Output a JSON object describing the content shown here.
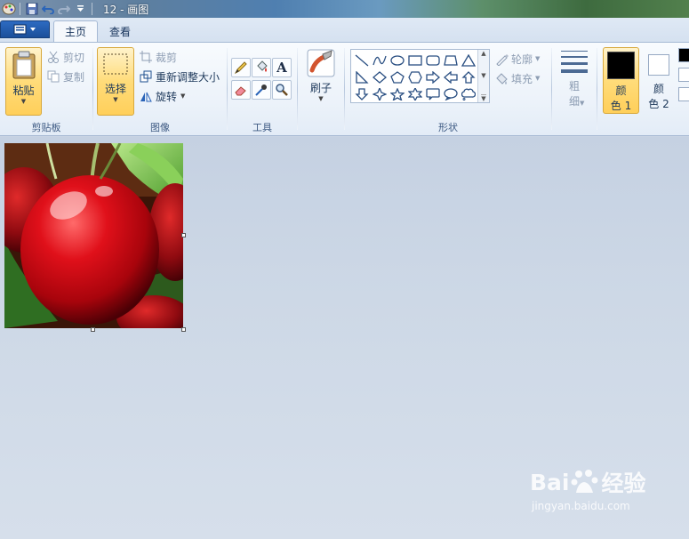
{
  "window": {
    "title": "12 - 画图"
  },
  "tabs": [
    {
      "label": "主页",
      "active": true
    },
    {
      "label": "查看",
      "active": false
    }
  ],
  "clipboard": {
    "paste_label": "粘贴",
    "cut_label": "剪切",
    "copy_label": "复制",
    "group_label": "剪贴板"
  },
  "image_group": {
    "select_label": "选择",
    "crop_label": "裁剪",
    "resize_label": "重新调整大小",
    "rotate_label": "旋转",
    "group_label": "图像"
  },
  "tools": {
    "group_label": "工具",
    "items": [
      "pencil-icon",
      "fill-icon",
      "text-icon",
      "eraser-icon",
      "color-picker-icon",
      "magnifier-icon"
    ]
  },
  "brushes": {
    "label": "刷子"
  },
  "shapes": {
    "group_label": "形状",
    "outline_label": "轮廓",
    "fill_label": "填充",
    "items": [
      "line",
      "curve",
      "oval",
      "rectangle",
      "rounded-rectangle",
      "polygon",
      "triangle",
      "right-triangle",
      "diamond",
      "pentagon",
      "hexagon",
      "right-arrow",
      "left-arrow",
      "up-arrow",
      "down-arrow",
      "four-point-star",
      "five-point-star",
      "six-point-star",
      "rounded-callout",
      "oval-callout",
      "cloud-callout"
    ]
  },
  "size": {
    "label_line1": "粗",
    "label_line2": "细"
  },
  "colors": {
    "color1_line1": "颜",
    "color1_line2": "色 1",
    "color2_line1": "颜",
    "color2_line2": "色 2",
    "color1_value": "#000000",
    "color2_value": "#ffffff",
    "accent_highlight": "#ffd86b"
  },
  "watermark": {
    "brand_left": "Bai",
    "brand_right": "经验",
    "sub": "jingyan.baidu.com"
  }
}
